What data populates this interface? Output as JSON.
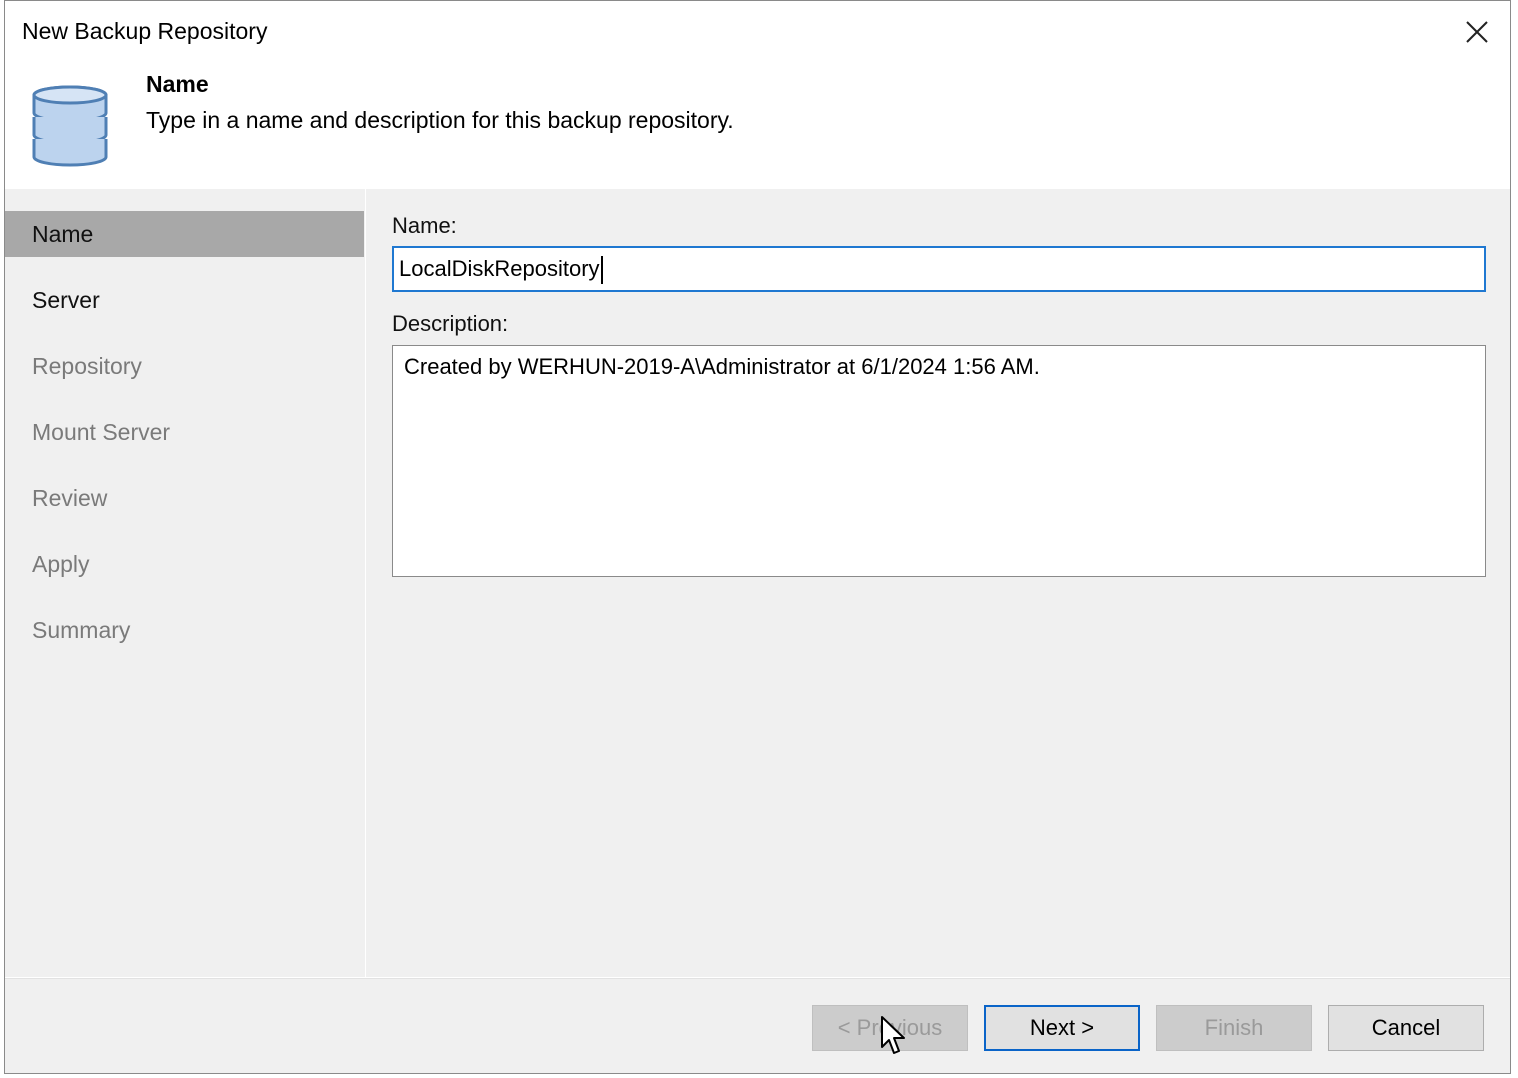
{
  "window": {
    "title": "New Backup Repository"
  },
  "header": {
    "title": "Name",
    "subtitle": "Type in a name and description for this backup repository.",
    "icon": "database-icon"
  },
  "steps": [
    {
      "label": "Name",
      "state": "active"
    },
    {
      "label": "Server",
      "state": "enabled"
    },
    {
      "label": "Repository",
      "state": "disabled"
    },
    {
      "label": "Mount Server",
      "state": "disabled"
    },
    {
      "label": "Review",
      "state": "disabled"
    },
    {
      "label": "Apply",
      "state": "disabled"
    },
    {
      "label": "Summary",
      "state": "disabled"
    }
  ],
  "form": {
    "name_label": "Name:",
    "name_value": "LocalDiskRepository",
    "description_label": "Description:",
    "description_value": "Created by WERHUN-2019-A\\Administrator at 6/1/2024 1:56 AM."
  },
  "buttons": {
    "previous": "< Previous",
    "next": "Next >",
    "finish": "Finish",
    "cancel": "Cancel"
  },
  "colors": {
    "accent": "#1f78d1",
    "active_step": "#a8a8a8",
    "panel": "#f0f0f0"
  }
}
